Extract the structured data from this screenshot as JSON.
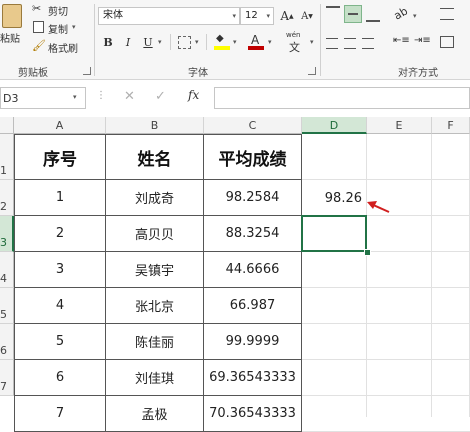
{
  "ribbon": {
    "clipboard": {
      "paste_label": "粘贴",
      "cut_label": "剪切",
      "copy_label": "复制",
      "format_painter_label": "格式刷",
      "group_label": "剪贴板"
    },
    "font": {
      "font_name": "宋体",
      "font_size": "12",
      "grow_label": "A",
      "shrink_label": "A",
      "bold_label": "B",
      "italic_label": "I",
      "underline_label": "U",
      "wen_label": "wén",
      "wen_char": "文",
      "group_label": "字体",
      "font_color": "#c00000",
      "fill_color": "#ffff00"
    },
    "alignment": {
      "group_label": "对齐方式"
    }
  },
  "formula_bar": {
    "name_box": "D3",
    "fx_label": "fx",
    "formula": ""
  },
  "sheet": {
    "columns": [
      "A",
      "B",
      "C",
      "D",
      "E",
      "F"
    ],
    "rows": [
      "1",
      "2",
      "3",
      "4",
      "5",
      "6",
      "7"
    ],
    "headers": [
      "序号",
      "姓名",
      "平均成绩"
    ],
    "records": [
      [
        "1",
        "刘成奇",
        "98.2584"
      ],
      [
        "2",
        "高贝贝",
        "88.3254"
      ],
      [
        "3",
        "吴镇宇",
        "44.6666"
      ],
      [
        "4",
        "张北京",
        "66.987"
      ],
      [
        "5",
        "陈佳丽",
        "99.9999"
      ],
      [
        "6",
        "刘佳琪",
        "69.36543333"
      ],
      [
        "7",
        "孟极",
        "70.36543333"
      ]
    ],
    "d2_value": "98.26",
    "selected_cell": "D3",
    "accent_color": "#217346",
    "arrow_color": "#d11f1f"
  }
}
